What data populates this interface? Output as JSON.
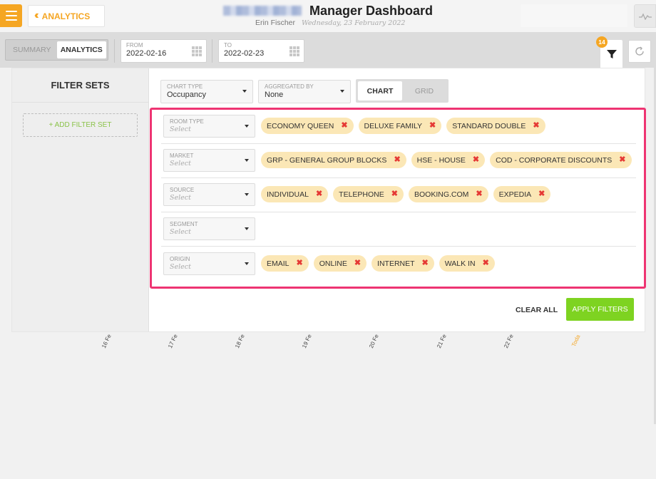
{
  "header": {
    "app_name": "ANALYTICS",
    "title": "Manager Dashboard",
    "user": "Erin Fischer",
    "date": "Wednesday, 23 February 2022"
  },
  "toolbar": {
    "view_tabs": [
      {
        "label": "SUMMARY",
        "active": false
      },
      {
        "label": "ANALYTICS",
        "active": true
      }
    ],
    "from": {
      "label": "FROM",
      "value": "2022-02-16"
    },
    "to": {
      "label": "TO",
      "value": "2022-02-23"
    },
    "filter_badge": "14"
  },
  "chart_axis": {
    "labels": [
      "16 Fe",
      "17 Fe",
      "18 Fe",
      "19 Fe",
      "20 Fe",
      "21 Fe",
      "22 Fe",
      "Toda"
    ]
  },
  "filter_sets": {
    "title": "FILTER SETS",
    "add_label": "+ ADD FILTER SET"
  },
  "controls": {
    "chart_type": {
      "label": "CHART TYPE",
      "value": "Occupancy"
    },
    "aggregated_by": {
      "label": "AGGREGATED BY",
      "value": "None"
    },
    "view_toggle": [
      {
        "label": "CHART",
        "active": true
      },
      {
        "label": "GRID",
        "active": false
      }
    ]
  },
  "filters": [
    {
      "label": "ROOM TYPE",
      "placeholder": "Select",
      "chips": [
        "ECONOMY QUEEN",
        "DELUXE FAMILY",
        "STANDARD DOUBLE"
      ]
    },
    {
      "label": "MARKET",
      "placeholder": "Select",
      "chips": [
        "GRP - GENERAL GROUP BLOCKS",
        "HSE - HOUSE",
        "COD - CORPORATE DISCOUNTS"
      ]
    },
    {
      "label": "SOURCE",
      "placeholder": "Select",
      "chips": [
        "INDIVIDUAL",
        "TELEPHONE",
        "BOOKING.COM",
        "EXPEDIA"
      ]
    },
    {
      "label": "SEGMENT",
      "placeholder": "Select",
      "chips": []
    },
    {
      "label": "ORIGIN",
      "placeholder": "Select",
      "chips": [
        "EMAIL",
        "ONLINE",
        "INTERNET",
        "WALK IN"
      ]
    }
  ],
  "actions": {
    "clear_all": "CLEAR ALL",
    "apply": "APPLY FILTERS"
  },
  "colors": {
    "accent": "#f5a623",
    "highlight": "#ee3472",
    "apply": "#7ed321",
    "chip": "#fbe7b6"
  }
}
